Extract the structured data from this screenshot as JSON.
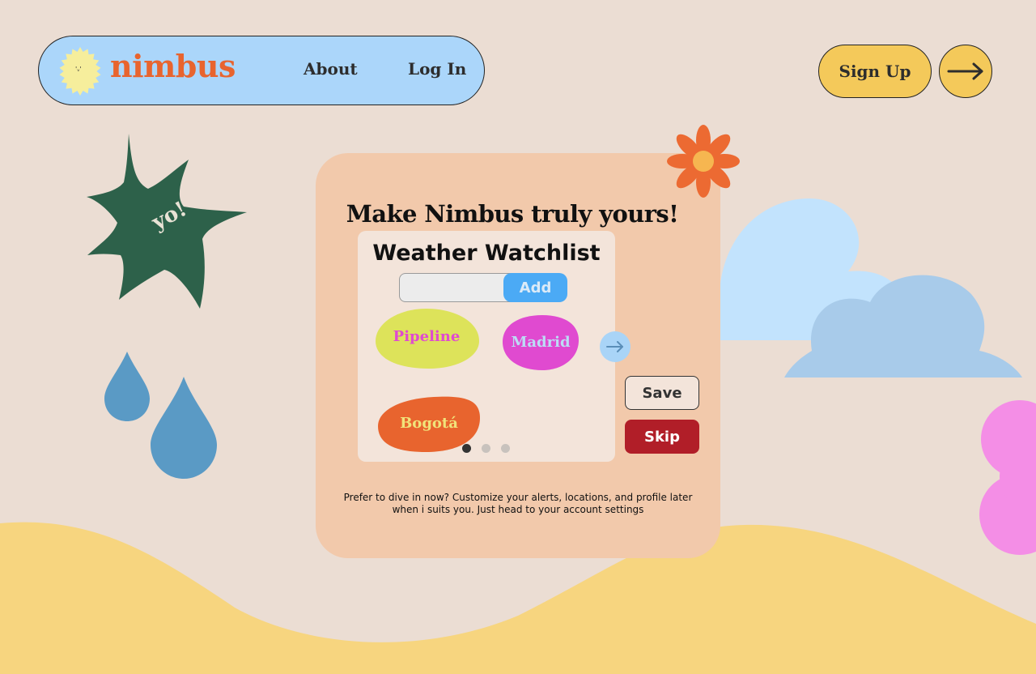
{
  "brand": {
    "name": "nimbus"
  },
  "nav": {
    "about": "About",
    "login": "Log In",
    "signup": "Sign Up"
  },
  "stickers": {
    "burst_text": "yo!"
  },
  "card": {
    "title": "Make Nimbus truly yours!",
    "panel_title": "Weather Watchlist",
    "input_placeholder": "",
    "add_label": "Add",
    "cities": [
      "Pipeline",
      "Madrid",
      "Bogotá"
    ],
    "save_label": "Save",
    "skip_label": "Skip",
    "footnote": "Prefer to dive in now? Customize your alerts, locations, and profile later when i suits you. Just head to your account settings",
    "pagination": {
      "current": 1,
      "total": 3
    }
  },
  "colors": {
    "background": "#ebddd3",
    "nav_blue": "#abd6fa",
    "brand_orange": "#e8642e",
    "button_yellow": "#f4c95a",
    "card_peach": "#f2c9ab",
    "add_blue": "#4baaf5",
    "skip_red": "#b11e28",
    "chip_pipeline": "#dde35a",
    "chip_madrid": "#e04ad0",
    "chip_bogota": "#e8642e",
    "sand": "#f7d57f"
  },
  "icons": {
    "logo": "sun-face-icon",
    "nav_arrow": "arrow-right-icon",
    "next": "arrow-right-icon"
  }
}
